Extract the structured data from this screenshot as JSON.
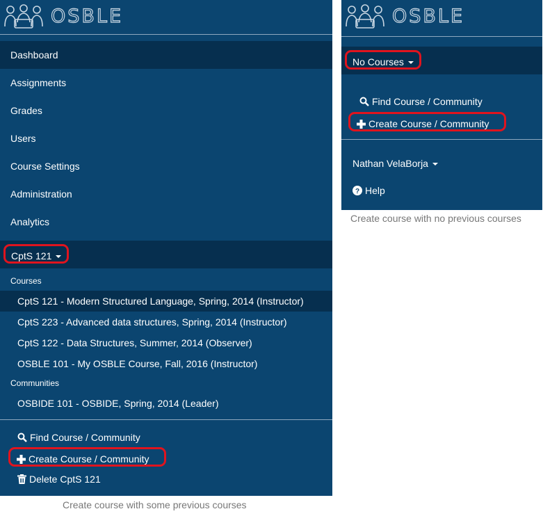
{
  "brand": "OSBLE",
  "colors": {
    "panel": "#0b4570",
    "active": "#062f4f",
    "highlight": "#e0141e"
  },
  "left": {
    "nav": [
      "Dashboard",
      "Assignments",
      "Grades",
      "Users",
      "Course Settings",
      "Administration",
      "Analytics"
    ],
    "current_course": "CptS 121",
    "courses_heading": "Courses",
    "courses": [
      "CptS 121 - Modern Structured Language, Spring, 2014 (Instructor)",
      "CptS 223 - Advanced data structures, Spring, 2014 (Instructor)",
      "CptS 122 - Data Structures, Summer, 2014 (Observer)",
      "OSBLE 101 - My OSBLE Course, Fall, 2016 (Instructor)"
    ],
    "communities_heading": "Communities",
    "communities": [
      "OSBIDE 101 - OSBIDE, Spring, 2014 (Leader)"
    ],
    "find_label": "Find Course / Community",
    "create_label": "Create Course / Community",
    "delete_label": "Delete CptS 121",
    "caption": "Create course with some previous courses"
  },
  "right": {
    "current_course": "No Courses",
    "find_label": "Find Course / Community",
    "create_label": "Create Course / Community",
    "user_name": "Nathan VelaBorja",
    "help_label": "Help",
    "caption": "Create course with no previous courses"
  },
  "icons": [
    "osble-logo-icon",
    "search-icon",
    "plus-icon",
    "trash-icon",
    "caret-down-icon",
    "help-circle-icon"
  ]
}
